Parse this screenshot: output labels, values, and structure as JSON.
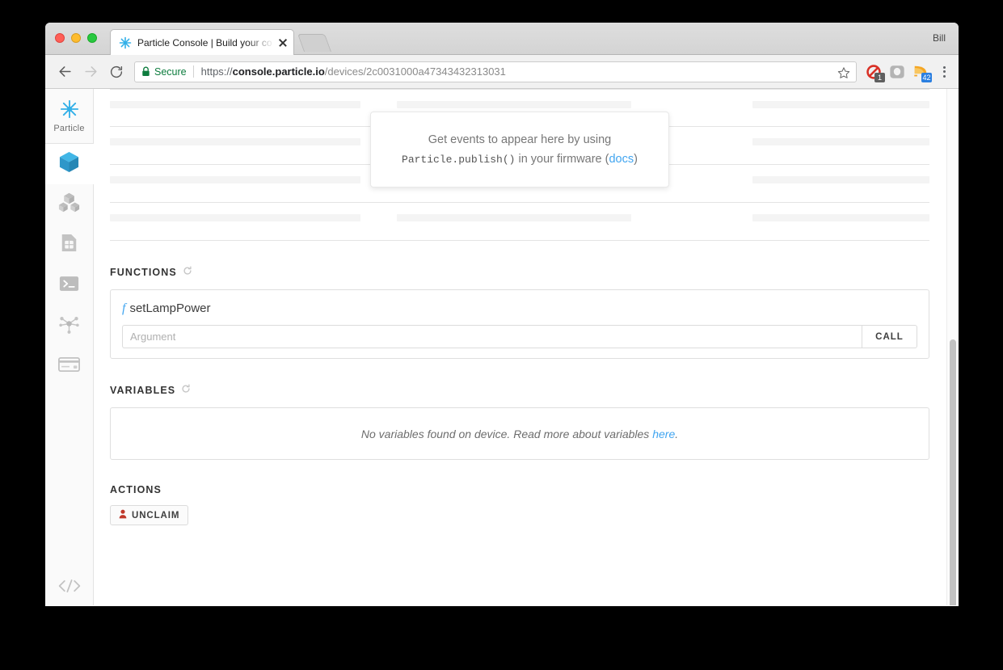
{
  "browser": {
    "profile_name": "Bill",
    "tab": {
      "title": "Particle Console | Build your co",
      "favicon": "particle-asterisk-icon",
      "close": "close-icon"
    },
    "newtab_label": "",
    "nav": {
      "back": "back-arrow-icon",
      "forward": "forward-arrow-icon",
      "reload": "reload-icon"
    },
    "omnibox": {
      "security_label": "Secure",
      "lock": "lock-icon",
      "url_scheme": "https://",
      "url_host": "console.particle.io",
      "url_path": "/devices/2c0031000a47343432313031",
      "full_url": "https://console.particle.io/devices/2c0031000a47343432313031",
      "bookmark": "star-icon"
    },
    "extensions": [
      {
        "name": "adblock-extension-icon",
        "badge": "1",
        "badge_color": "#5f5f5f"
      },
      {
        "name": "pocket-extension-icon",
        "badge": "",
        "badge_color": ""
      },
      {
        "name": "feedly-extension-icon",
        "badge": "42",
        "badge_color": "#2b7fe0"
      }
    ],
    "menu": "kebab-menu-icon"
  },
  "sidebar": {
    "logo": {
      "icon": "particle-asterisk-icon",
      "label": "Particle"
    },
    "items": [
      {
        "icon": "cube-icon",
        "label": "Devices",
        "active": true
      },
      {
        "icon": "cubes-icon",
        "label": "Products",
        "active": false
      },
      {
        "icon": "sim-card-icon",
        "label": "SIM Cards",
        "active": false
      },
      {
        "icon": "console-terminal-icon",
        "label": "Logs",
        "active": false
      },
      {
        "icon": "integrations-nodes-icon",
        "label": "Integrations",
        "active": false
      },
      {
        "icon": "credit-card-icon",
        "label": "Billing",
        "active": false
      }
    ],
    "bottom_item": {
      "icon": "code-brackets-icon",
      "label": "Docs"
    }
  },
  "events": {
    "placeholder_rows": 5,
    "callout": {
      "line1": "Get events to appear here by using",
      "code": "Particle.publish()",
      "line2_before": " in your firmware (",
      "link": "docs",
      "line2_after": ")"
    }
  },
  "functions": {
    "heading": "FUNCTIONS",
    "refresh_icon": "refresh-icon",
    "items": [
      {
        "prefix": "f",
        "name": "setLampPower",
        "argument_value": "",
        "argument_placeholder": "Argument",
        "call_label": "CALL"
      }
    ]
  },
  "variables": {
    "heading": "VARIABLES",
    "refresh_icon": "refresh-icon",
    "empty_message_before": "No variables found on device. Read more about variables ",
    "empty_message_link": "here",
    "empty_message_after": "."
  },
  "actions": {
    "heading": "ACTIONS",
    "unclaim_label": "UNCLAIM",
    "unclaim_icon": "person-icon",
    "unclaim_icon_color": "#c0392b"
  },
  "scrollbar": {
    "name": "page-scrollbar"
  }
}
